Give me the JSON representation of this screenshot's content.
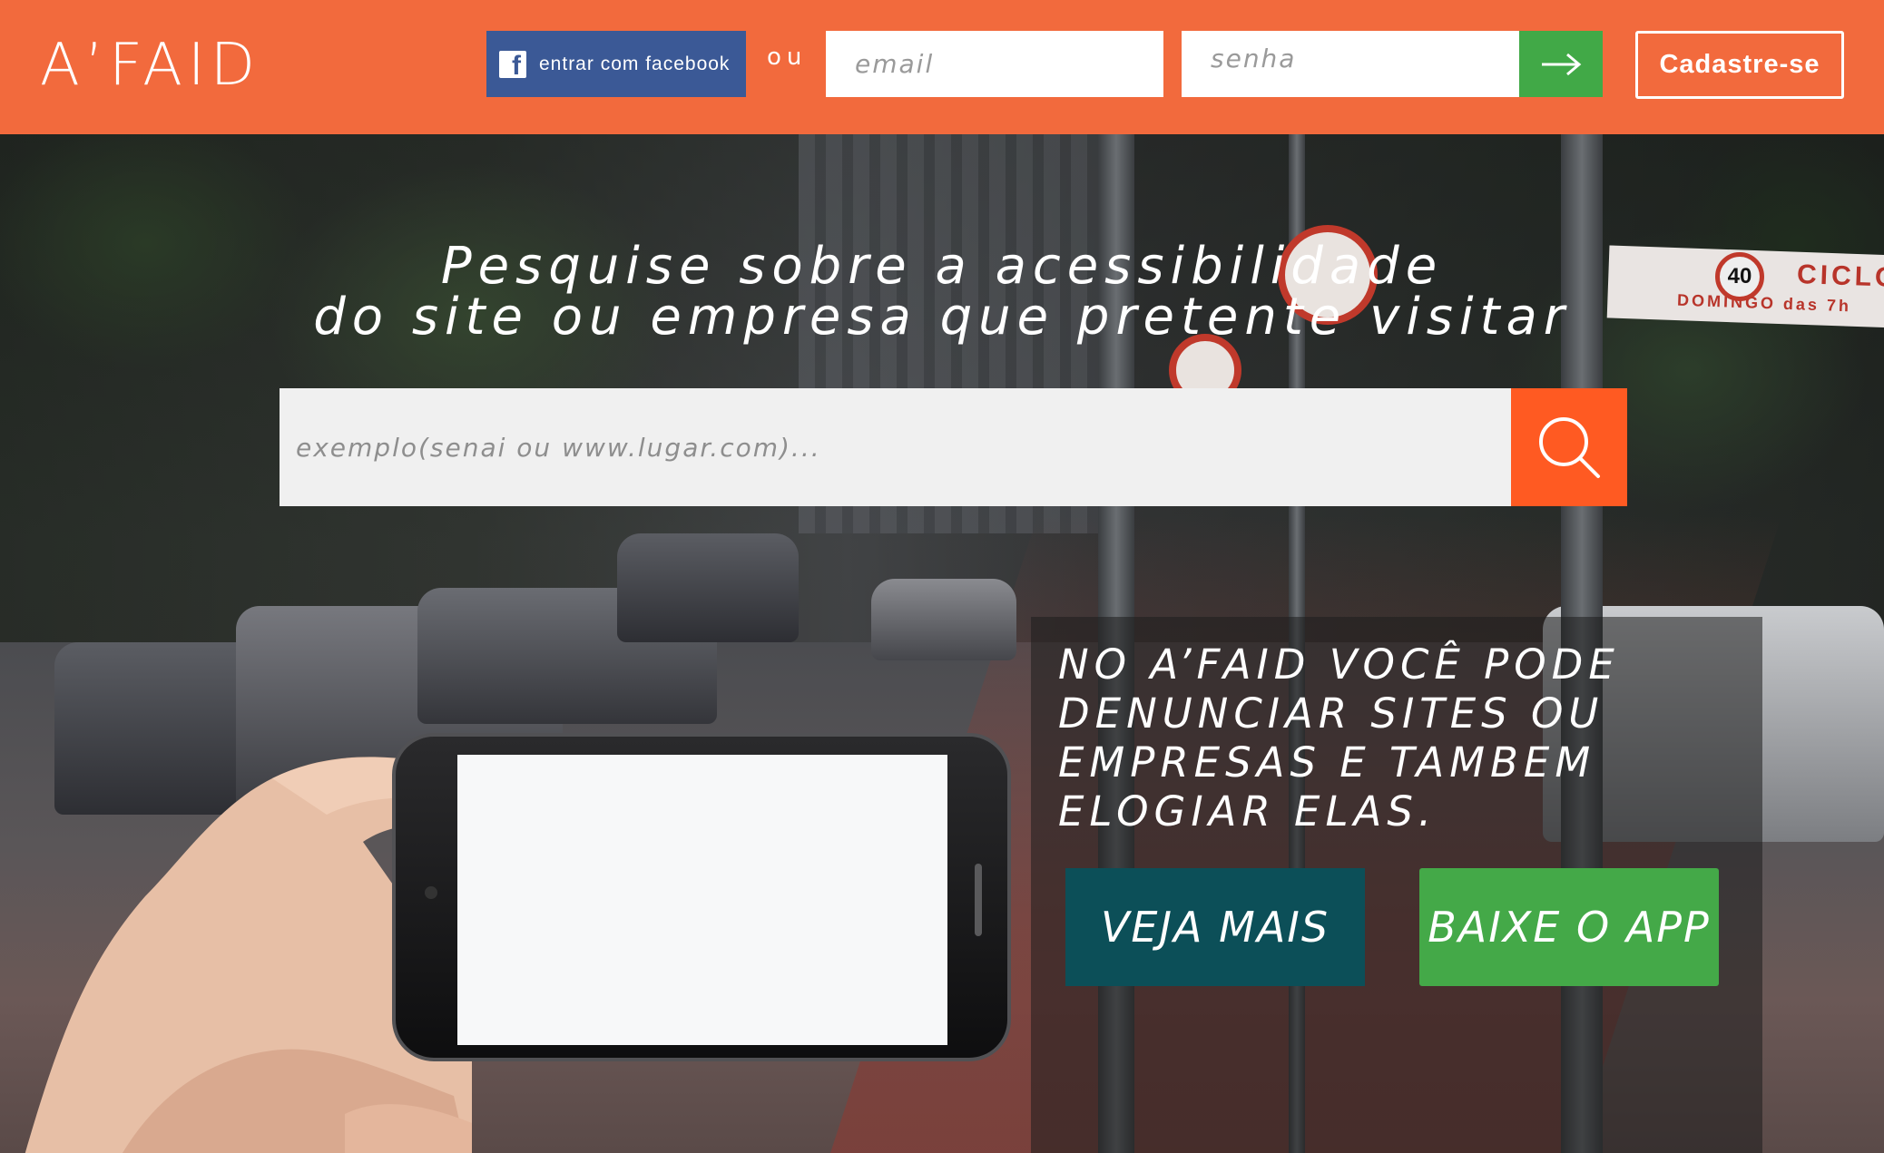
{
  "header": {
    "logo": "A’FAID",
    "facebook_label": "entrar com facebook",
    "or_label": "ou",
    "email_placeholder": "email",
    "password_placeholder": "senha",
    "signup_label": "Cadastre-se",
    "brand_color": "#f26a3d",
    "facebook_color": "#3b5996",
    "submit_color": "#41a947"
  },
  "hero": {
    "headline_line1": "Pesquise sobre a acessibilidade",
    "headline_line2": "do site ou empresa que pretente visitar",
    "search_placeholder": "exemplo(senai ou www.lugar.com)...",
    "search_button_color": "#ff5a22",
    "background_sign_text": "CICLO",
    "background_sign_subtext": "DOMINGO das 7h",
    "background_speed_sign": "40"
  },
  "info": {
    "text": "NO A’FAID VOCÊ PODE DENUNCIAR SITES OU EMPRESAS E TAMBEM ELOGIAR ELAS.",
    "more_button": "VEJA MAIS",
    "app_button": "BAIXE O APP",
    "more_color": "#0c4f58",
    "app_color": "#44a948"
  },
  "icons": {
    "facebook": "facebook-icon",
    "arrow": "arrow-right-icon",
    "search": "search-icon"
  }
}
